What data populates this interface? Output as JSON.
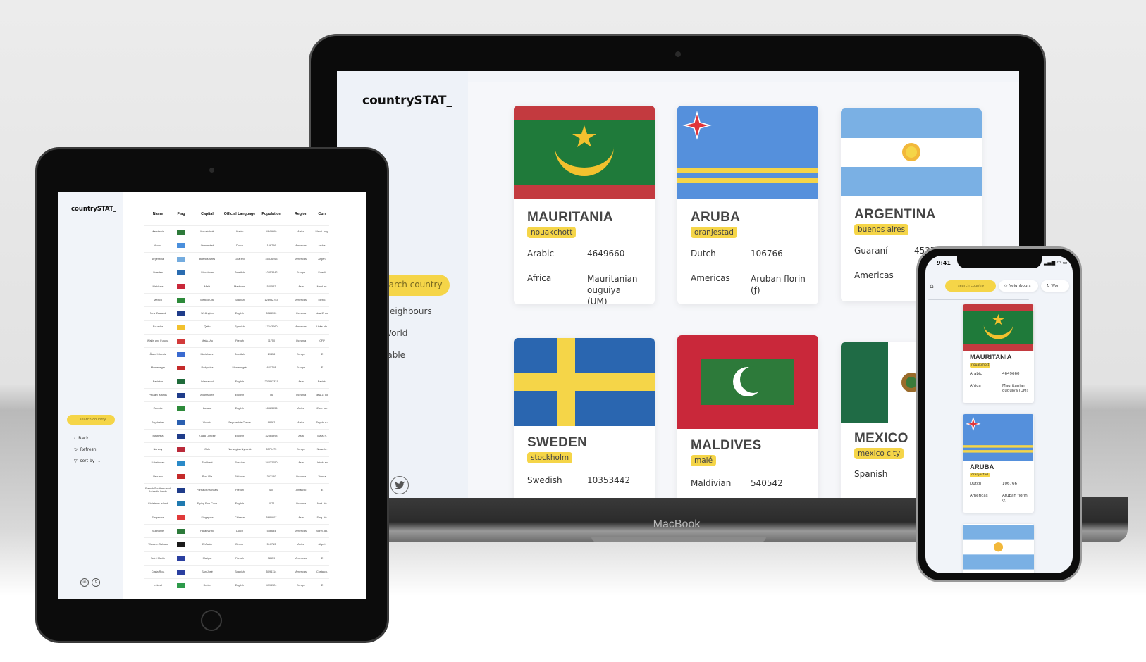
{
  "brand": "countrySTAT_",
  "device_label": "MacBook",
  "laptop": {
    "search_placeholder": "search country",
    "nav": [
      "Neighbours",
      "World",
      "Table"
    ],
    "social": [
      "in",
      "tw"
    ],
    "cards": [
      {
        "name": "MAURITANIA",
        "capital": "nouakchott",
        "language": "Arabic",
        "population": "4649660",
        "region": "Africa",
        "currency": "Mauritanian ouguiya (UM)",
        "flag": "mauritania-flag"
      },
      {
        "name": "ARUBA",
        "capital": "oranjestad",
        "language": "Dutch",
        "population": "106766",
        "region": "Americas",
        "currency": "Aruban florin (ƒ)",
        "flag": "aruba-flag"
      },
      {
        "name": "ARGENTINA",
        "capital": "buenos aires",
        "language": "Guaraní",
        "population": "45376763",
        "region": "Americas",
        "currency": "",
        "flag": "argentina-flag"
      },
      {
        "name": "SWEDEN",
        "capital": "stockholm",
        "language": "Swedish",
        "population": "10353442",
        "region": "",
        "currency": "",
        "flag": "sweden-flag"
      },
      {
        "name": "MALDIVES",
        "capital": "malé",
        "language": "Maldivian",
        "population": "540542",
        "region": "",
        "currency": "",
        "flag": "maldives-flag"
      },
      {
        "name": "MEXICO",
        "capital": "mexico city",
        "language": "Spanish",
        "population": "",
        "region": "",
        "currency": "",
        "flag": "mexico-flag"
      }
    ]
  },
  "tablet": {
    "search_placeholder": "search country",
    "nav": {
      "back": "Back",
      "refresh": "Refresh",
      "sort": "sort by"
    },
    "columns": [
      "Name",
      "Flag",
      "Capital",
      "Official Language",
      "Population",
      "Region",
      "Curr"
    ],
    "rows": [
      [
        "Mauritania",
        "#2d7a3a",
        "Nouakchott",
        "Arabic",
        "4649660",
        "Africa",
        "Mauri. oug."
      ],
      [
        "Aruba",
        "#4a8fdc",
        "Oranjestad",
        "Dutch",
        "106766",
        "Americas",
        "Aruba."
      ],
      [
        "Argentina",
        "#74acdf",
        "Buenos Aires",
        "Guaraní",
        "45376763",
        "Americas",
        "Argen."
      ],
      [
        "Sweden",
        "#2a6cb0",
        "Stockholm",
        "Swedish",
        "10353442",
        "Europe",
        "Swedi."
      ],
      [
        "Maldives",
        "#c9283a",
        "Malé",
        "Maldivian",
        "540542",
        "Asia",
        "Mald. ru."
      ],
      [
        "Mexico",
        "#2d8a3a",
        "Mexico City",
        "Spanish",
        "128932753",
        "Americas",
        "Mexic."
      ],
      [
        "New Zealand",
        "#1f3c8a",
        "Wellington",
        "English",
        "5084300",
        "Oceania",
        "New Z. do."
      ],
      [
        "Ecuador",
        "#f2c12e",
        "Quito",
        "Spanish",
        "17643060",
        "Americas",
        "Unite. do."
      ],
      [
        "Wallis and Futuna",
        "#d23a3a",
        "Mata-Utu",
        "French",
        "11750",
        "Oceania",
        "CFP"
      ],
      [
        "Åland Islands",
        "#3a6ad0",
        "Mariehamn",
        "Swedish",
        "29458",
        "Europe",
        "E"
      ],
      [
        "Montenegro",
        "#c42a2a",
        "Podgorica",
        "Montenegrin",
        "621718",
        "Europe",
        "E"
      ],
      [
        "Pakistan",
        "#1f6b3a",
        "Islamabad",
        "English",
        "220892331",
        "Asia",
        "Pakista"
      ],
      [
        "Pitcairn Islands",
        "#1f3c8a",
        "Adamstown",
        "English",
        "56",
        "Oceania",
        "New Z. do."
      ],
      [
        "Zambia",
        "#2d8a3a",
        "Lusaka",
        "English",
        "18383956",
        "Africa",
        "Zam. kw."
      ],
      [
        "Seychelles",
        "#2a5fb0",
        "Victoria",
        "Seychellois Creole",
        "98462",
        "Africa",
        "Seych. ru."
      ],
      [
        "Malaysia",
        "#1f3c8a",
        "Kuala Lumpur",
        "English",
        "32365998",
        "Asia",
        "Mala. ri."
      ],
      [
        "Norway",
        "#ba2a3a",
        "Oslo",
        "Norwegian Nynorsk",
        "5379475",
        "Europe",
        "Norw. kr."
      ],
      [
        "Uzbekistan",
        "#2a8ac8",
        "Tashkent",
        "Russian",
        "34232050",
        "Asia",
        "Uzbek. so."
      ],
      [
        "Vanuatu",
        "#c42a2a",
        "Port Vila",
        "Bislama",
        "307150",
        "Oceania",
        "Vanua"
      ],
      [
        "French Southern and Antarctic Lands",
        "#1f3c8a",
        "Port-aux-Français",
        "French",
        "400",
        "Antarctic",
        "E"
      ],
      [
        "Christmas Island",
        "#1f7ab0",
        "Flying Fish Cove",
        "English",
        "2072",
        "Oceania",
        "Aust. do."
      ],
      [
        "Singapore",
        "#e03a3a",
        "Singapore",
        "Chinese",
        "5685807",
        "Asia",
        "Sing. do."
      ],
      [
        "Suriname",
        "#2d7a3a",
        "Paramaribo",
        "Dutch",
        "586634",
        "Americas",
        "Surin. do."
      ],
      [
        "Western Sahara",
        "#1a1a1a",
        "El Aaiún",
        "Berber",
        "510713",
        "Africa",
        "Algeri."
      ],
      [
        "Saint Martin",
        "#2a3fa0",
        "Marigot",
        "French",
        "38659",
        "Americas",
        "E"
      ],
      [
        "Costa Rica",
        "#2a3fa0",
        "San José",
        "Spanish",
        "5094114",
        "Americas",
        "Costa co."
      ],
      [
        "Ireland",
        "#2d9a4a",
        "Dublin",
        "English",
        "4994724",
        "Europe",
        "E"
      ]
    ],
    "social": [
      "in",
      "tw"
    ]
  },
  "phone": {
    "time": "9:41",
    "search_placeholder": "search country",
    "pills": [
      "Neighbours",
      "Wor"
    ],
    "cards": [
      {
        "name": "MAURITANIA",
        "capital": "nouakchott",
        "language": "Arabic",
        "population": "4649660",
        "region": "Africa",
        "currency": "Mauritanian ouguiya (UM)"
      },
      {
        "name": "ARUBA",
        "capital": "oranjestad",
        "language": "Dutch",
        "population": "106766",
        "region": "Americas",
        "currency": "Aruban florin (ƒ)"
      }
    ]
  },
  "colors": {
    "accent": "#f5d548",
    "sidebar": "#eef2f8"
  }
}
